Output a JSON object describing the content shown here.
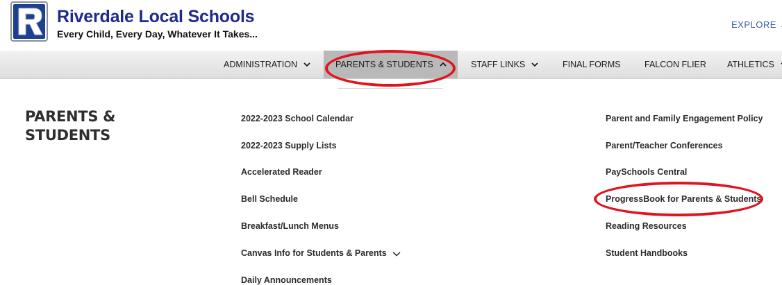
{
  "brand": {
    "logo_letter": "R",
    "title": "Riverdale Local Schools",
    "tagline": "Every Child, Every Day, Whatever It Takes..."
  },
  "header": {
    "explore": "EXPLORE"
  },
  "nav": {
    "items": [
      {
        "label": "ADMINISTRATION",
        "has_dropdown": true
      },
      {
        "label": "PARENTS & STUDENTS",
        "has_dropdown": true,
        "active": true
      },
      {
        "label": "STAFF LINKS",
        "has_dropdown": true
      },
      {
        "label": "FINAL FORMS",
        "has_dropdown": false
      },
      {
        "label": "FALCON FLIER",
        "has_dropdown": false
      },
      {
        "label": "ATHLETICS",
        "has_dropdown": true
      }
    ]
  },
  "section": {
    "title": "PARENTS & STUDENTS"
  },
  "links": {
    "left": [
      {
        "label": "2022-2023 School Calendar"
      },
      {
        "label": "2022-2023 Supply Lists"
      },
      {
        "label": "Accelerated Reader"
      },
      {
        "label": "Bell Schedule"
      },
      {
        "label": "Breakfast/Lunch Menus"
      },
      {
        "label": "Canvas Info for Students & Parents",
        "has_dropdown": true
      },
      {
        "label": "Daily Announcements"
      }
    ],
    "right": [
      {
        "label": "Parent and Family Engagement Policy"
      },
      {
        "label": "Parent/Teacher Conferences"
      },
      {
        "label": "PaySchools Central"
      },
      {
        "label": "ProgressBook for Parents & Students",
        "highlighted": true
      },
      {
        "label": "Reading Resources"
      },
      {
        "label": "Student Handbooks"
      }
    ]
  },
  "colors": {
    "brand_blue": "#1f2a8c",
    "annotation_red": "#e0141e",
    "active_tab": "#b9b9b9"
  }
}
